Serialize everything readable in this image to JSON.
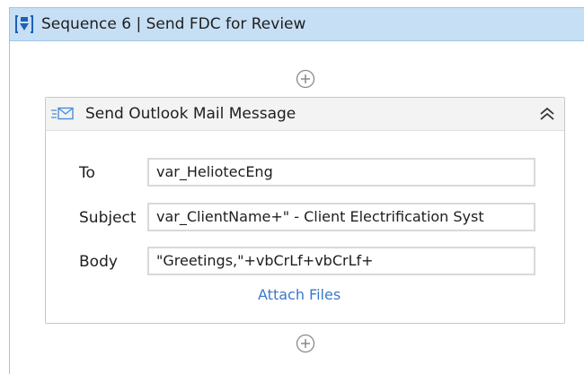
{
  "sequence": {
    "title": "Sequence 6 | Send FDC for Review",
    "icon": "sequence-icon"
  },
  "activity": {
    "title": "Send Outlook Mail Message",
    "icon": "mail-icon",
    "collapse_icon": "chevron-double-up-icon",
    "fields": {
      "to": {
        "label": "To",
        "value": "var_HeliotecEng"
      },
      "subject": {
        "label": "Subject",
        "value": "var_ClientName+\" - Client Electrification Syst"
      },
      "body": {
        "label": "Body",
        "value": "\"Greetings,\"+vbCrLf+vbCrLf+"
      }
    },
    "attach_files_label": "Attach Files"
  },
  "colors": {
    "header_bg": "#c6dff5",
    "link": "#3c78c8"
  }
}
